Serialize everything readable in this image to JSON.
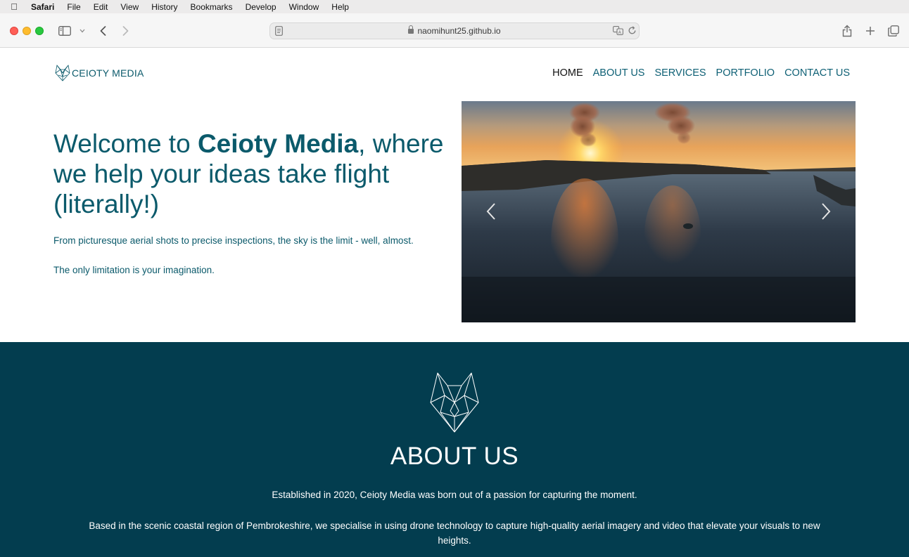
{
  "menubar": {
    "app": "Safari",
    "items": [
      "File",
      "Edit",
      "View",
      "History",
      "Bookmarks",
      "Develop",
      "Window",
      "Help"
    ]
  },
  "browser": {
    "url": "naomihunt25.github.io",
    "icons": [
      "sidebar-icon",
      "chevron-down-icon",
      "back-icon",
      "forward-icon",
      "reader-icon",
      "lock-icon",
      "translate-icon",
      "reload-icon",
      "share-icon",
      "new-tab-icon",
      "tabs-overview-icon"
    ]
  },
  "site": {
    "logo_text": "CEIOTY MEDIA",
    "nav": [
      "HOME",
      "ABOUT US",
      "SERVICES",
      "PORTFOLIO",
      "CONTACT US"
    ],
    "active_nav": "HOME",
    "hero": {
      "title_before": "Welcome to ",
      "title_brand": "Ceioty Media",
      "title_after": ", where we help your ideas take flight (literally!)",
      "text1": "From picturesque aerial shots to precise inspections, the sky is the limit - well, almost.",
      "text2": "The only limitation is your imagination."
    },
    "about": {
      "title": "ABOUT US",
      "p1": "Established in 2020, Ceioty Media was born out of a passion for capturing the moment.",
      "p2": "Based in the scenic coastal region of Pembrokeshire, we specialise in using drone technology to capture high-quality aerial imagery and video that elevate your visuals to new heights."
    },
    "colors": {
      "brand_teal": "#0b5a6b",
      "about_bg": "#033d4f"
    }
  }
}
